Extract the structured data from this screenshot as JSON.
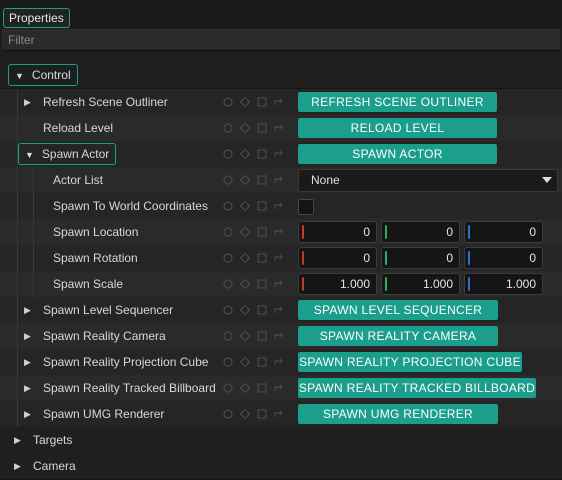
{
  "tab": {
    "label": "Properties"
  },
  "filter": {
    "placeholder": "Filter"
  },
  "categories": {
    "control": "Control",
    "targets": "Targets",
    "camera": "Camera"
  },
  "rows": {
    "refresh_scene_outliner": {
      "label": "Refresh Scene Outliner",
      "button": "REFRESH SCENE OUTLINER"
    },
    "reload_level": {
      "label": "Reload Level",
      "button": "RELOAD LEVEL"
    },
    "spawn_actor": {
      "label": "Spawn Actor",
      "button": "SPAWN ACTOR"
    },
    "actor_list": {
      "label": "Actor List",
      "value": "None"
    },
    "spawn_to_world": {
      "label": "Spawn To World Coordinates",
      "checked": false
    },
    "spawn_location": {
      "label": "Spawn Location",
      "x": "0",
      "y": "0",
      "z": "0"
    },
    "spawn_rotation": {
      "label": "Spawn Rotation",
      "x": "0",
      "y": "0",
      "z": "0"
    },
    "spawn_scale": {
      "label": "Spawn Scale",
      "x": "1.000",
      "y": "1.000",
      "z": "1.000"
    },
    "spawn_level_sequencer": {
      "label": "Spawn Level Sequencer",
      "button": "SPAWN LEVEL SEQUENCER"
    },
    "spawn_reality_camera": {
      "label": "Spawn Reality Camera",
      "button": "SPAWN REALITY CAMERA"
    },
    "spawn_reality_projection_cube": {
      "label": "Spawn Reality Projection Cube",
      "button": "SPAWN REALITY PROJECTION CUBE"
    },
    "spawn_reality_tracked_billboard": {
      "label": "Spawn Reality Tracked Billboard",
      "button": "SPAWN REALITY TRACKED BILLBOARD"
    },
    "spawn_umg_renderer": {
      "label": "Spawn UMG Renderer",
      "button": "SPAWN UMG RENDERER"
    }
  },
  "colors": {
    "accent": "#1b9e8b",
    "axis_x": "#c0392b",
    "axis_y": "#27ae60",
    "axis_z": "#2f6fd6"
  },
  "icons": [
    "expand-arrow-icon",
    "collapse-arrow-icon",
    "reset-circle-icon",
    "keyframe-diamond-icon",
    "square-icon",
    "link-arrow-icon",
    "dropdown-caret-icon"
  ]
}
